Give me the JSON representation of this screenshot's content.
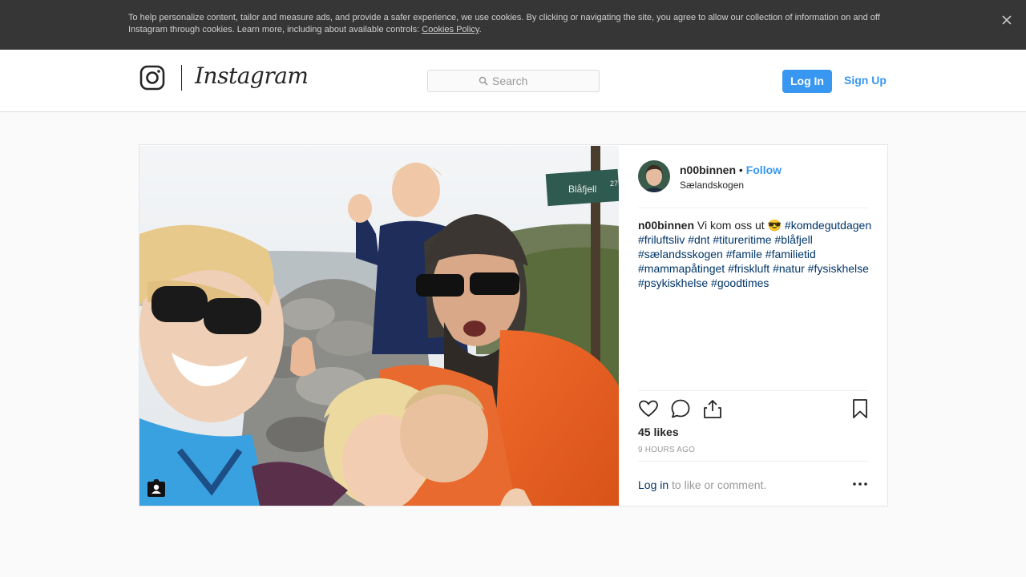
{
  "cookie_banner": {
    "text": "To help personalize content, tailor and measure ads, and provide a safer experience, we use cookies. By clicking or navigating the site, you agree to allow our collection of information on and off Instagram through cookies. Learn more, including about available controls: ",
    "link": "Cookies Policy",
    "trailing": "."
  },
  "header": {
    "wordmark": "Instagram",
    "search_placeholder": "Search",
    "login_label": "Log In",
    "signup_label": "Sign Up"
  },
  "post": {
    "username": "n00binnen",
    "separator": "•",
    "follow_label": "Follow",
    "location": "Sælandskogen",
    "caption_user": "n00binnen",
    "caption_text": "Vi kom oss ut 😎",
    "hashtags": [
      "#komdegutdagen",
      "#friluftsliv",
      "#dnt",
      "#titureritime",
      "#blåfjell",
      "#sælandsskogen",
      "#famile",
      "#familietid",
      "#mammapåtinget",
      "#friskluft",
      "#natur",
      "#fysiskhelse",
      "#psykiskhelse",
      "#goodtimes"
    ],
    "likes": "45 likes",
    "time": "9 HOURS AGO",
    "comment_login": "Log in",
    "comment_rest": " to like or comment.",
    "sign_text": "Blåfjell",
    "sign_number": "27"
  },
  "icons": {
    "close": "close-icon",
    "logo": "instagram-camera-icon",
    "search": "search-icon",
    "like": "heart-icon",
    "comment": "comment-bubble-icon",
    "share": "share-icon",
    "save": "bookmark-icon",
    "more": "more-options-icon",
    "tagged": "tagged-users-icon"
  },
  "colors": {
    "accent": "#3897f0",
    "hashtag": "#003569",
    "banner_bg": "#363636"
  }
}
